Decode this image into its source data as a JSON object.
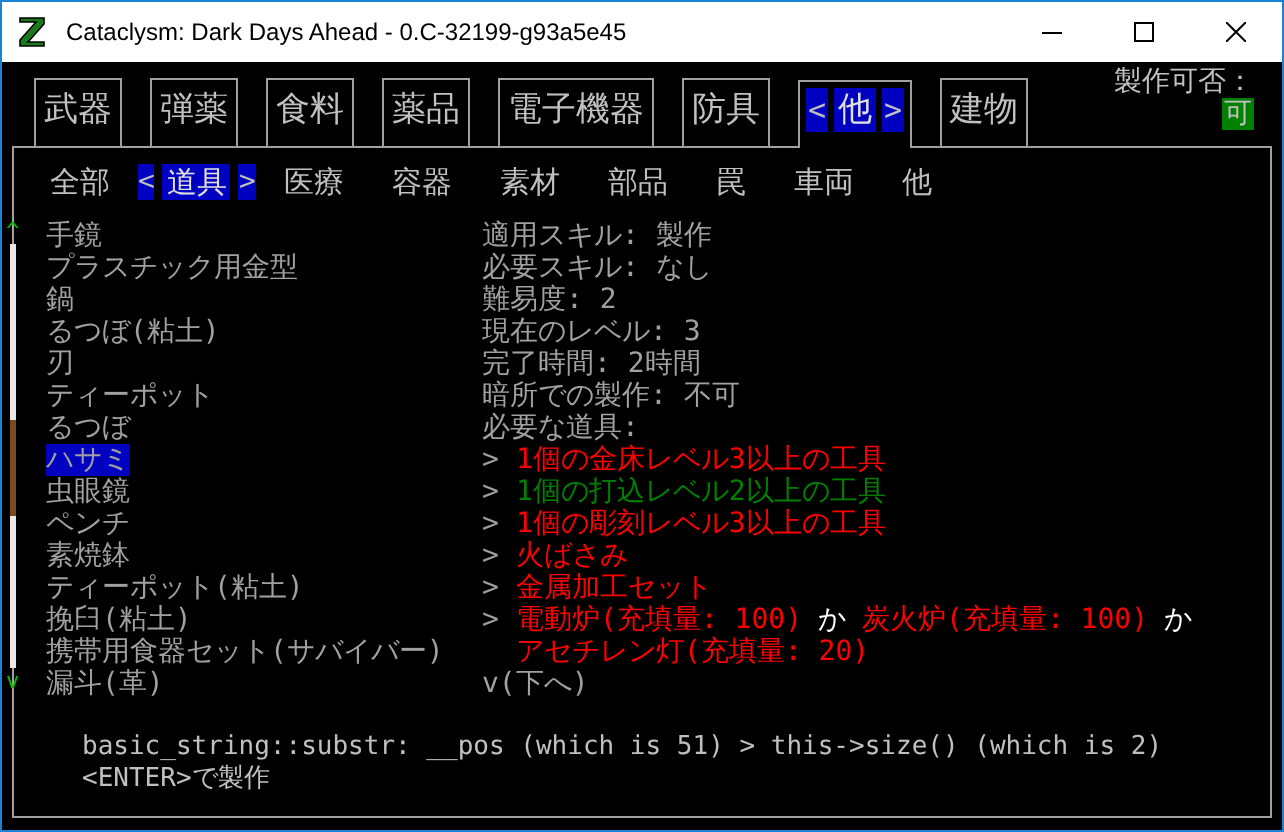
{
  "window": {
    "title": "Cataclysm: Dark Days Ahead - 0.C-32199-g93a5e45"
  },
  "tabs": {
    "prev_marker": "<",
    "next_marker": ">",
    "items": [
      {
        "label": "武器",
        "selected": false
      },
      {
        "label": "弾薬",
        "selected": false
      },
      {
        "label": "食料",
        "selected": false
      },
      {
        "label": "薬品",
        "selected": false
      },
      {
        "label": "電子機器",
        "selected": false
      },
      {
        "label": "防具",
        "selected": false
      },
      {
        "label": "他",
        "selected": true
      },
      {
        "label": "建物",
        "selected": false
      }
    ]
  },
  "craftable": {
    "label": "製作可否：",
    "value": "可"
  },
  "subtabs": {
    "prev_marker": "<",
    "next_marker": ">",
    "items": [
      {
        "label": "全部",
        "selected": false
      },
      {
        "label": "道具",
        "selected": true
      },
      {
        "label": "医療",
        "selected": false
      },
      {
        "label": "容器",
        "selected": false
      },
      {
        "label": "素材",
        "selected": false
      },
      {
        "label": "部品",
        "selected": false
      },
      {
        "label": "罠",
        "selected": false
      },
      {
        "label": "車両",
        "selected": false
      },
      {
        "label": "他",
        "selected": false
      }
    ]
  },
  "scroll": {
    "up": "^",
    "down": "v"
  },
  "recipes": [
    {
      "label": "手鏡",
      "selected": false
    },
    {
      "label": "プラスチック用金型",
      "selected": false
    },
    {
      "label": "鍋",
      "selected": false
    },
    {
      "label": "るつぼ(粘土)",
      "selected": false
    },
    {
      "label": "刃",
      "selected": false
    },
    {
      "label": "ティーポット",
      "selected": false
    },
    {
      "label": "るつぼ",
      "selected": false
    },
    {
      "label": "ハサミ",
      "selected": true
    },
    {
      "label": "虫眼鏡",
      "selected": false
    },
    {
      "label": "ペンチ",
      "selected": false
    },
    {
      "label": "素焼鉢",
      "selected": false
    },
    {
      "label": "ティーポット(粘土)",
      "selected": false
    },
    {
      "label": "挽臼(粘土)",
      "selected": false
    },
    {
      "label": "携帯用食器セット(サバイバー)",
      "selected": false
    },
    {
      "label": "漏斗(革)",
      "selected": false
    }
  ],
  "details": [
    {
      "kind": "plain",
      "text": "適用スキル: 製作"
    },
    {
      "kind": "plain",
      "text": "必要スキル: なし"
    },
    {
      "kind": "plain",
      "text": "難易度: 2"
    },
    {
      "kind": "plain",
      "text": "現在のレベル: 3"
    },
    {
      "kind": "plain",
      "text": "完了時間: 2時間"
    },
    {
      "kind": "plain",
      "text": "暗所での製作: 不可"
    },
    {
      "kind": "plain",
      "text": "必要な道具:"
    },
    {
      "kind": "requirement",
      "marker": ">",
      "parts": [
        {
          "text": "1個の金床レベル3以上の工具",
          "color": "#ff0000"
        }
      ]
    },
    {
      "kind": "requirement",
      "marker": ">",
      "parts": [
        {
          "text": "1個の打込レベル2以上の工具",
          "color": "#008000"
        }
      ]
    },
    {
      "kind": "requirement",
      "marker": ">",
      "parts": [
        {
          "text": "1個の彫刻レベル3以上の工具",
          "color": "#ff0000"
        }
      ]
    },
    {
      "kind": "requirement",
      "marker": ">",
      "parts": [
        {
          "text": "火ばさみ",
          "color": "#ff0000"
        }
      ]
    },
    {
      "kind": "requirement",
      "marker": ">",
      "parts": [
        {
          "text": "金属加工セット",
          "color": "#ff0000"
        }
      ]
    },
    {
      "kind": "requirement",
      "marker": ">",
      "parts": [
        {
          "text": "電動炉(充填量: 100)",
          "color": "#ff0000"
        },
        {
          "text": "か",
          "color": "#ffffff"
        },
        {
          "text": "炭火炉(充填量: 100)",
          "color": "#ff0000"
        },
        {
          "text": "か",
          "color": "#ffffff"
        }
      ]
    },
    {
      "kind": "continuation",
      "parts": [
        {
          "text": "アセチレン灯(充填量: 20)",
          "color": "#ff0000"
        }
      ]
    },
    {
      "kind": "plain",
      "text": "v(下へ)"
    }
  ],
  "messages": [
    "basic_string::substr: __pos (which is 51) > this->size() (which is 2)",
    "<ENTER>で製作"
  ]
}
